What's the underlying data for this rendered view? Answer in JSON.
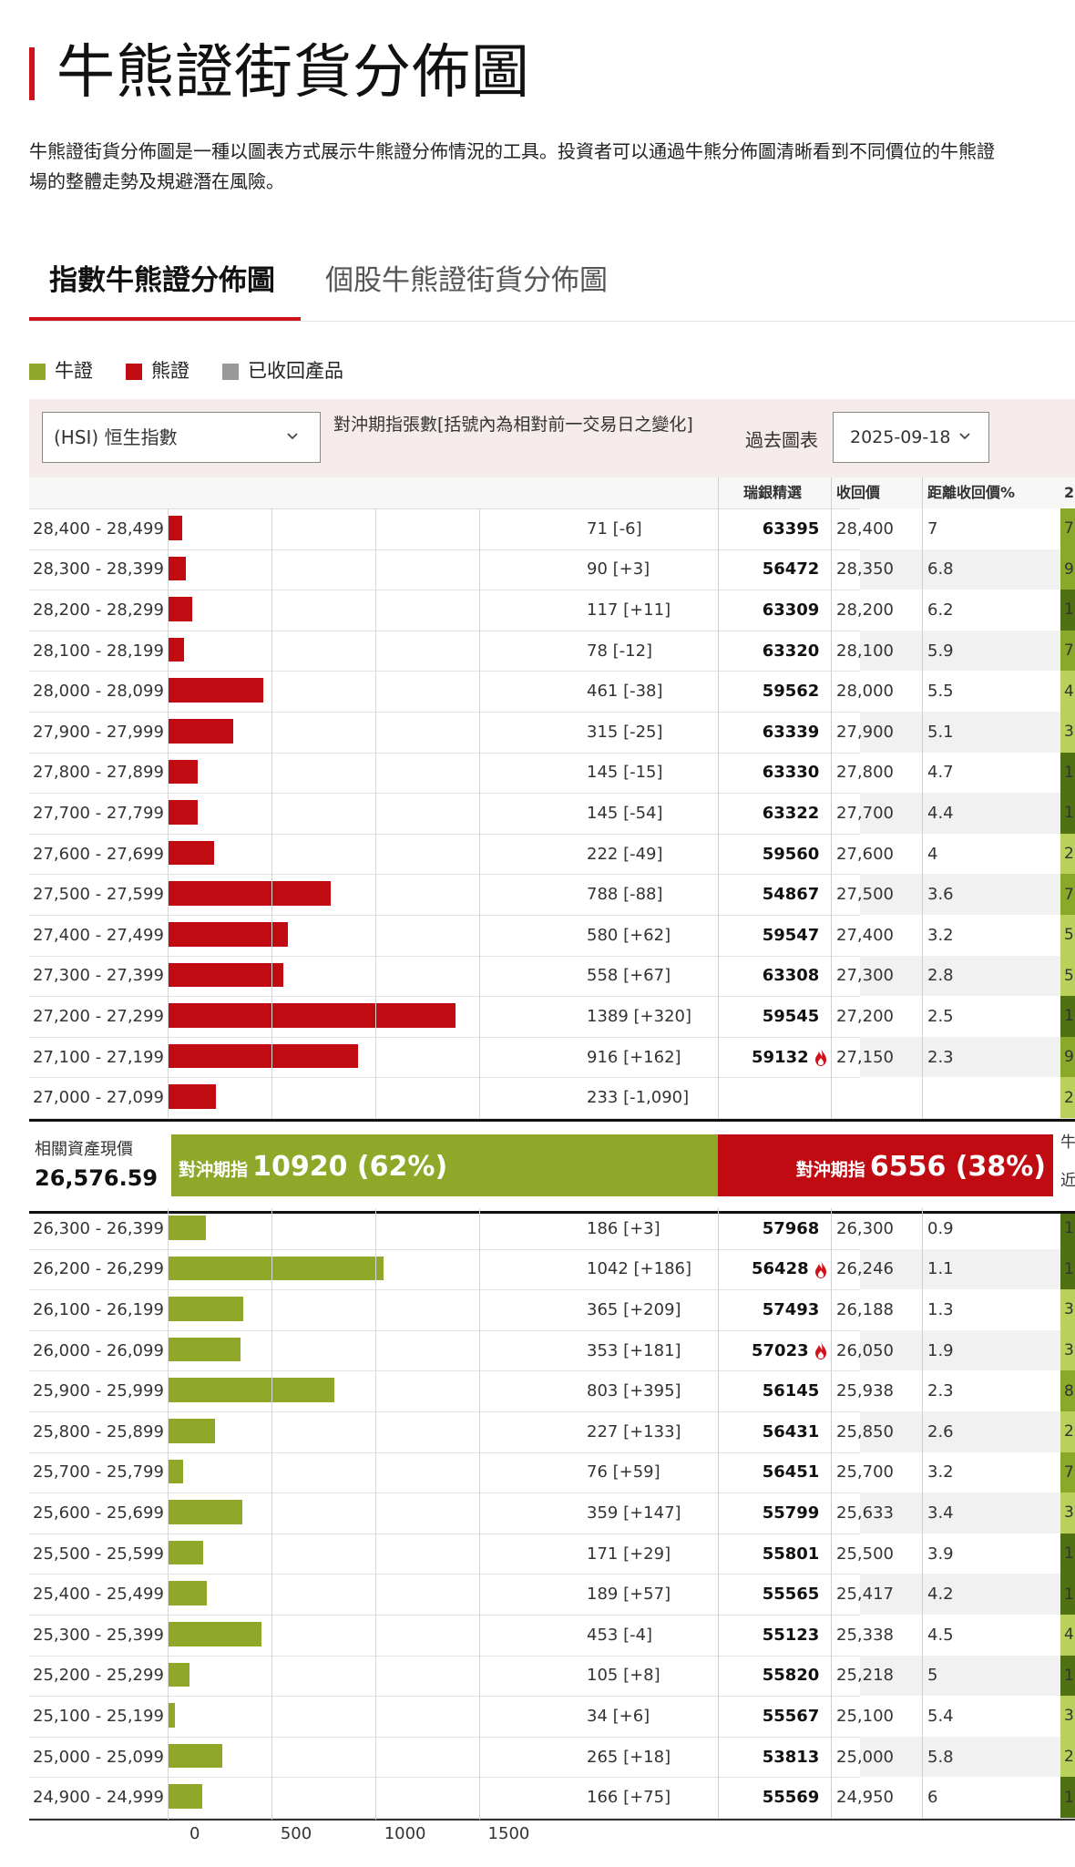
{
  "page": {
    "title": "牛熊證街貨分佈圖",
    "intro_line1": "牛熊證街貨分佈圖是一種以圖表方式展示牛熊證分佈情況的工具。投資者可以通過牛熊分佈圖清晰看到不同價位的牛熊證",
    "intro_line2": "場的整體走勢及規避潛在風險。"
  },
  "tabs": [
    {
      "label": "指數牛熊證分佈圖",
      "active": true
    },
    {
      "label": "個股牛熊證街貨分佈圖",
      "active": false
    }
  ],
  "legend": [
    {
      "label": "牛證",
      "color": "#8fa82a"
    },
    {
      "label": "熊證",
      "color": "#c10b13"
    },
    {
      "label": "已收回產品",
      "color": "#999999"
    }
  ],
  "controls": {
    "index_select": "(HSI) 恒生指數",
    "description": "對沖期指張數[括號內為相對前一交易日之變化]",
    "history_label": "過去圖表",
    "date_select": "2025-09-18"
  },
  "columns": {
    "ubs": "瑞銀精選",
    "call_price": "收回價",
    "distance": "距離收回價%",
    "extra": "2"
  },
  "colors": {
    "bull": "#8fa82a",
    "bear": "#c10b13",
    "accent": "#d0121b"
  },
  "middle": {
    "label": "相關資產現價",
    "price": "26,576.59",
    "bull_prefix": "對沖期指",
    "bull_value": "10920 (62%)",
    "bear_prefix": "對沖期指",
    "bear_value": "6556 (38%)",
    "cut1": "牛",
    "cut2": "近"
  },
  "chart_data": {
    "type": "bar",
    "orientation": "horizontal",
    "xlim": [
      0,
      2000
    ],
    "x_ticks": [
      "0",
      "500",
      "1000",
      "1500"
    ],
    "bear_rows": [
      {
        "range": "28,400 - 28,499",
        "value": 71,
        "label": "71 [-6]",
        "ubs": "63395",
        "fire": false,
        "call": "28,400",
        "dist": "7",
        "extra": "7"
      },
      {
        "range": "28,300 - 28,399",
        "value": 90,
        "label": "90 [+3]",
        "ubs": "56472",
        "fire": false,
        "call": "28,350",
        "dist": "6.8",
        "extra": "9"
      },
      {
        "range": "28,200 - 28,299",
        "value": 117,
        "label": "117 [+11]",
        "ubs": "63309",
        "fire": false,
        "call": "28,200",
        "dist": "6.2",
        "extra": "1"
      },
      {
        "range": "28,100 - 28,199",
        "value": 78,
        "label": "78 [-12]",
        "ubs": "63320",
        "fire": false,
        "call": "28,100",
        "dist": "5.9",
        "extra": "7"
      },
      {
        "range": "28,000 - 28,099",
        "value": 461,
        "label": "461 [-38]",
        "ubs": "59562",
        "fire": false,
        "call": "28,000",
        "dist": "5.5",
        "extra": "4"
      },
      {
        "range": "27,900 - 27,999",
        "value": 315,
        "label": "315 [-25]",
        "ubs": "63339",
        "fire": false,
        "call": "27,900",
        "dist": "5.1",
        "extra": "3"
      },
      {
        "range": "27,800 - 27,899",
        "value": 145,
        "label": "145 [-15]",
        "ubs": "63330",
        "fire": false,
        "call": "27,800",
        "dist": "4.7",
        "extra": "1"
      },
      {
        "range": "27,700 - 27,799",
        "value": 145,
        "label": "145 [-54]",
        "ubs": "63322",
        "fire": false,
        "call": "27,700",
        "dist": "4.4",
        "extra": "1"
      },
      {
        "range": "27,600 - 27,699",
        "value": 222,
        "label": "222 [-49]",
        "ubs": "59560",
        "fire": false,
        "call": "27,600",
        "dist": "4",
        "extra": "2"
      },
      {
        "range": "27,500 - 27,599",
        "value": 788,
        "label": "788 [-88]",
        "ubs": "54867",
        "fire": false,
        "call": "27,500",
        "dist": "3.6",
        "extra": "7"
      },
      {
        "range": "27,400 - 27,499",
        "value": 580,
        "label": "580 [+62]",
        "ubs": "59547",
        "fire": false,
        "call": "27,400",
        "dist": "3.2",
        "extra": "5"
      },
      {
        "range": "27,300 - 27,399",
        "value": 558,
        "label": "558 [+67]",
        "ubs": "63308",
        "fire": false,
        "call": "27,300",
        "dist": "2.8",
        "extra": "5"
      },
      {
        "range": "27,200 - 27,299",
        "value": 1389,
        "label": "1389 [+320]",
        "ubs": "59545",
        "fire": false,
        "call": "27,200",
        "dist": "2.5",
        "extra": "1"
      },
      {
        "range": "27,100 - 27,199",
        "value": 916,
        "label": "916 [+162]",
        "ubs": "59132",
        "fire": true,
        "call": "27,150",
        "dist": "2.3",
        "extra": "9"
      },
      {
        "range": "27,000 - 27,099",
        "value": 233,
        "label": "233 [-1,090]",
        "ubs": "",
        "fire": false,
        "call": "",
        "dist": "",
        "extra": "2"
      }
    ],
    "bull_rows": [
      {
        "range": "26,300 - 26,399",
        "value": 186,
        "label": "186 [+3]",
        "ubs": "57968",
        "fire": false,
        "call": "26,300",
        "dist": "0.9",
        "extra": "1"
      },
      {
        "range": "26,200 - 26,299",
        "value": 1042,
        "label": "1042 [+186]",
        "ubs": "56428",
        "fire": true,
        "call": "26,246",
        "dist": "1.1",
        "extra": "1"
      },
      {
        "range": "26,100 - 26,199",
        "value": 365,
        "label": "365 [+209]",
        "ubs": "57493",
        "fire": false,
        "call": "26,188",
        "dist": "1.3",
        "extra": "3"
      },
      {
        "range": "26,000 - 26,099",
        "value": 353,
        "label": "353 [+181]",
        "ubs": "57023",
        "fire": true,
        "call": "26,050",
        "dist": "1.9",
        "extra": "3"
      },
      {
        "range": "25,900 - 25,999",
        "value": 803,
        "label": "803 [+395]",
        "ubs": "56145",
        "fire": false,
        "call": "25,938",
        "dist": "2.3",
        "extra": "8"
      },
      {
        "range": "25,800 - 25,899",
        "value": 227,
        "label": "227 [+133]",
        "ubs": "56431",
        "fire": false,
        "call": "25,850",
        "dist": "2.6",
        "extra": "2"
      },
      {
        "range": "25,700 - 25,799",
        "value": 76,
        "label": "76 [+59]",
        "ubs": "56451",
        "fire": false,
        "call": "25,700",
        "dist": "3.2",
        "extra": "7"
      },
      {
        "range": "25,600 - 25,699",
        "value": 359,
        "label": "359 [+147]",
        "ubs": "55799",
        "fire": false,
        "call": "25,633",
        "dist": "3.4",
        "extra": "3"
      },
      {
        "range": "25,500 - 25,599",
        "value": 171,
        "label": "171 [+29]",
        "ubs": "55801",
        "fire": false,
        "call": "25,500",
        "dist": "3.9",
        "extra": "1"
      },
      {
        "range": "25,400 - 25,499",
        "value": 189,
        "label": "189 [+57]",
        "ubs": "55565",
        "fire": false,
        "call": "25,417",
        "dist": "4.2",
        "extra": "1"
      },
      {
        "range": "25,300 - 25,399",
        "value": 453,
        "label": "453 [-4]",
        "ubs": "55123",
        "fire": false,
        "call": "25,338",
        "dist": "4.5",
        "extra": "4"
      },
      {
        "range": "25,200 - 25,299",
        "value": 105,
        "label": "105 [+8]",
        "ubs": "55820",
        "fire": false,
        "call": "25,218",
        "dist": "5",
        "extra": "1"
      },
      {
        "range": "25,100 - 25,199",
        "value": 34,
        "label": "34 [+6]",
        "ubs": "55567",
        "fire": false,
        "call": "25,100",
        "dist": "5.4",
        "extra": "3"
      },
      {
        "range": "25,000 - 25,099",
        "value": 265,
        "label": "265 [+18]",
        "ubs": "53813",
        "fire": false,
        "call": "25,000",
        "dist": "5.8",
        "extra": "2"
      },
      {
        "range": "24,900 - 24,999",
        "value": 166,
        "label": "166 [+75]",
        "ubs": "55569",
        "fire": false,
        "call": "24,950",
        "dist": "6",
        "extra": "1"
      }
    ]
  }
}
